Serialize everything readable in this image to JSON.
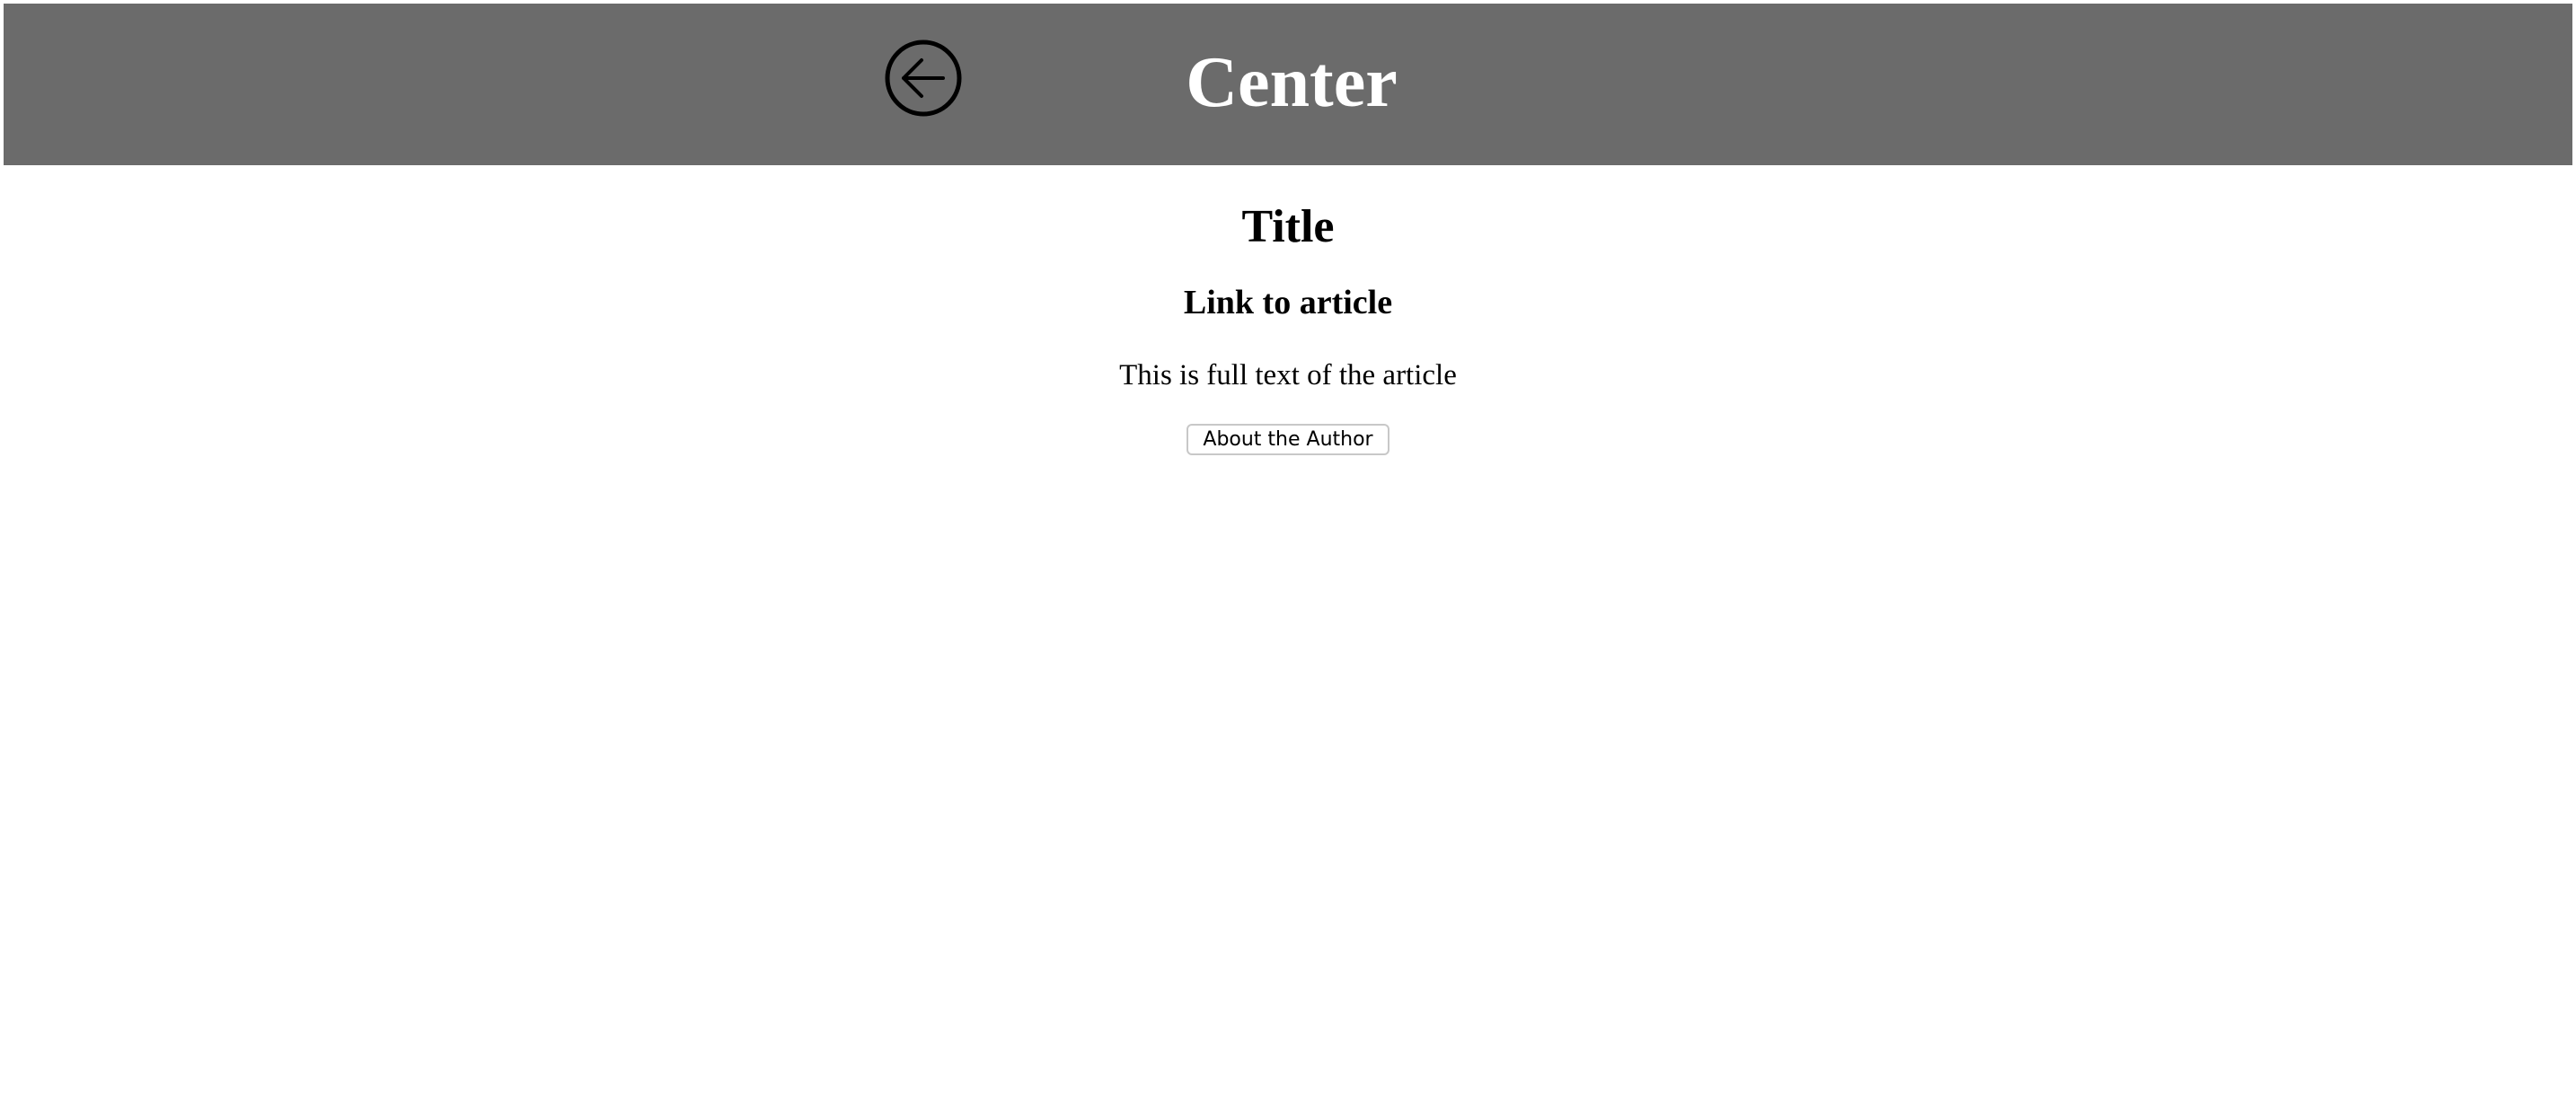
{
  "header": {
    "title": "Center",
    "background_color": "#6b6b6b",
    "back_icon": "arrow-left-circle-icon"
  },
  "article": {
    "title": "Title",
    "link_label": "Link to article",
    "body": "This is full text of the article",
    "author_button_label": "About the Author"
  }
}
